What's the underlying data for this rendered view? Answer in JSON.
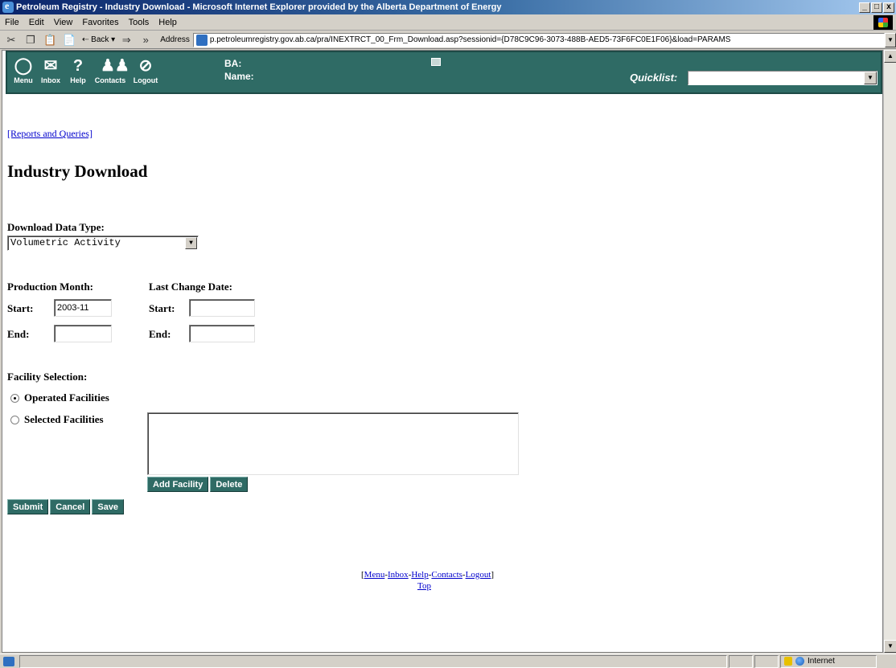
{
  "window": {
    "title": "Petroleum Registry - Industry Download - Microsoft Internet Explorer provided by the Alberta Department of Energy",
    "controls": {
      "minimize": "_",
      "maximize": "□",
      "close": "x"
    }
  },
  "menubar": {
    "items": [
      "File",
      "Edit",
      "View",
      "Favorites",
      "Tools",
      "Help"
    ]
  },
  "toolbar": {
    "back_label": "Back",
    "address_label": "Address",
    "address_value": "p.petroleumregistry.gov.ab.ca/pra/INEXTRCT_00_Frm_Download.asp?sessionid={D78C9C96-3073-488B-AED5-73F6FC0E1F06}&load=PARAMS"
  },
  "app_header": {
    "nav": [
      "Menu",
      "Inbox",
      "Help",
      "Contacts",
      "Logout"
    ],
    "ba_label": "BA:",
    "name_label": "Name:",
    "quicklist_label": "Quicklist:",
    "quicklist_value": ""
  },
  "page": {
    "breadcrumb_link": "[Reports and Queries]",
    "title": "Industry Download",
    "download_type_label": "Download Data Type:",
    "download_type_value": "Volumetric Activity",
    "production_month_label": "Production Month:",
    "last_change_label": "Last Change Date:",
    "start_label": "Start:",
    "end_label": "End:",
    "production_start_value": "2003-11",
    "production_end_value": "",
    "change_start_value": "",
    "change_end_value": "",
    "facility_selection_label": "Facility Selection:",
    "radio_operated": "Operated Facilities",
    "radio_selected": "Selected Facilities",
    "radio_checked": "operated",
    "facility_buttons": [
      "Add Facility",
      "Delete"
    ],
    "form_buttons": [
      "Submit",
      "Cancel",
      "Save"
    ]
  },
  "footer": {
    "open_bracket": "[",
    "close_bracket": "]",
    "separator": "-",
    "links": [
      "Menu",
      "Inbox",
      "Help",
      "Contacts",
      "Logout"
    ],
    "top_link": "Top"
  },
  "statusbar": {
    "zone": "Internet"
  },
  "colors": {
    "app_header": "#2f6b65",
    "link": "#0000cc",
    "titlebar": "#0a246a"
  }
}
